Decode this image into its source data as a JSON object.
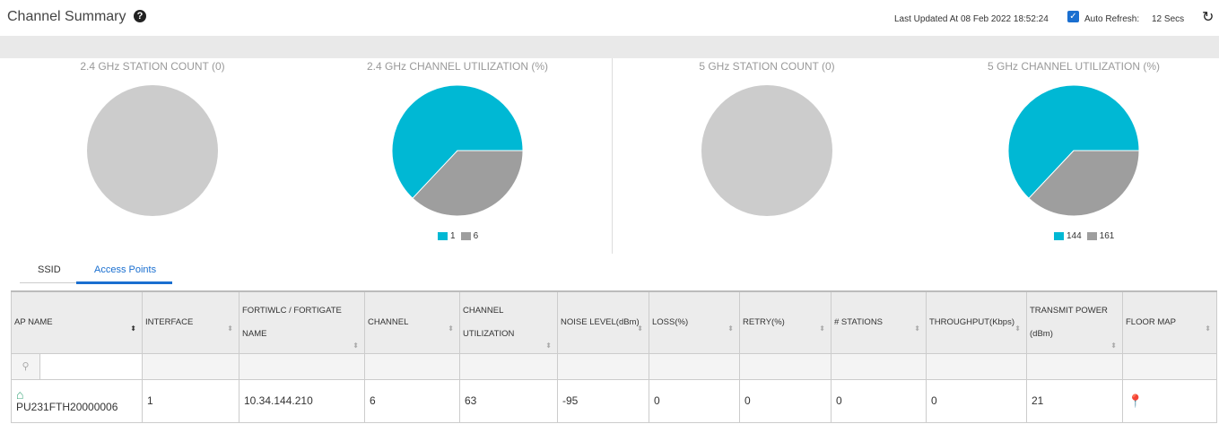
{
  "header": {
    "title": "Channel Summary",
    "last_updated": "Last Updated At 08 Feb 2022 18:52:24",
    "auto_refresh_label": "Auto Refresh:",
    "auto_refresh_checked": true,
    "refresh_interval": "12 Secs"
  },
  "chart_data": [
    {
      "type": "pie",
      "title": "2.4 GHz STATION COUNT (0)",
      "slices": [],
      "empty": true
    },
    {
      "type": "pie",
      "title": "2.4 GHz CHANNEL UTILIZATION (%)",
      "slices": [
        {
          "label": "1",
          "value": 63,
          "color": "#00b8d4"
        },
        {
          "label": "6",
          "value": 37,
          "color": "#9e9e9e"
        }
      ]
    },
    {
      "type": "pie",
      "title": "5 GHz STATION COUNT (0)",
      "slices": [],
      "empty": true
    },
    {
      "type": "pie",
      "title": "5 GHz CHANNEL UTILIZATION (%)",
      "slices": [
        {
          "label": "144",
          "value": 63,
          "color": "#00b8d4"
        },
        {
          "label": "161",
          "value": 37,
          "color": "#9e9e9e"
        }
      ]
    }
  ],
  "tabs": [
    {
      "label": "SSID",
      "active": false
    },
    {
      "label": "Access Points",
      "active": true
    }
  ],
  "table": {
    "columns": [
      "AP NAME",
      "INTERFACE",
      "FORTIWLC / FORTIGATE NAME",
      "CHANNEL",
      "CHANNEL UTILIZATION",
      "NOISE LEVEL(dBm)",
      "LOSS(%)",
      "RETRY(%)",
      "# STATIONS",
      "THROUGHPUT(Kbps)",
      "TRANSMIT POWER (dBm)",
      "FLOOR MAP"
    ],
    "rows": [
      [
        "PU231FTH20000006",
        "1",
        "10.34.144.210",
        "6",
        "63",
        "-95",
        "0",
        "0",
        "0",
        "0",
        "21",
        ""
      ]
    ]
  },
  "colors": {
    "accent": "#1a6fd0",
    "cyan": "#00b8d4",
    "gray": "#9e9e9e",
    "empty": "#cccccc"
  }
}
